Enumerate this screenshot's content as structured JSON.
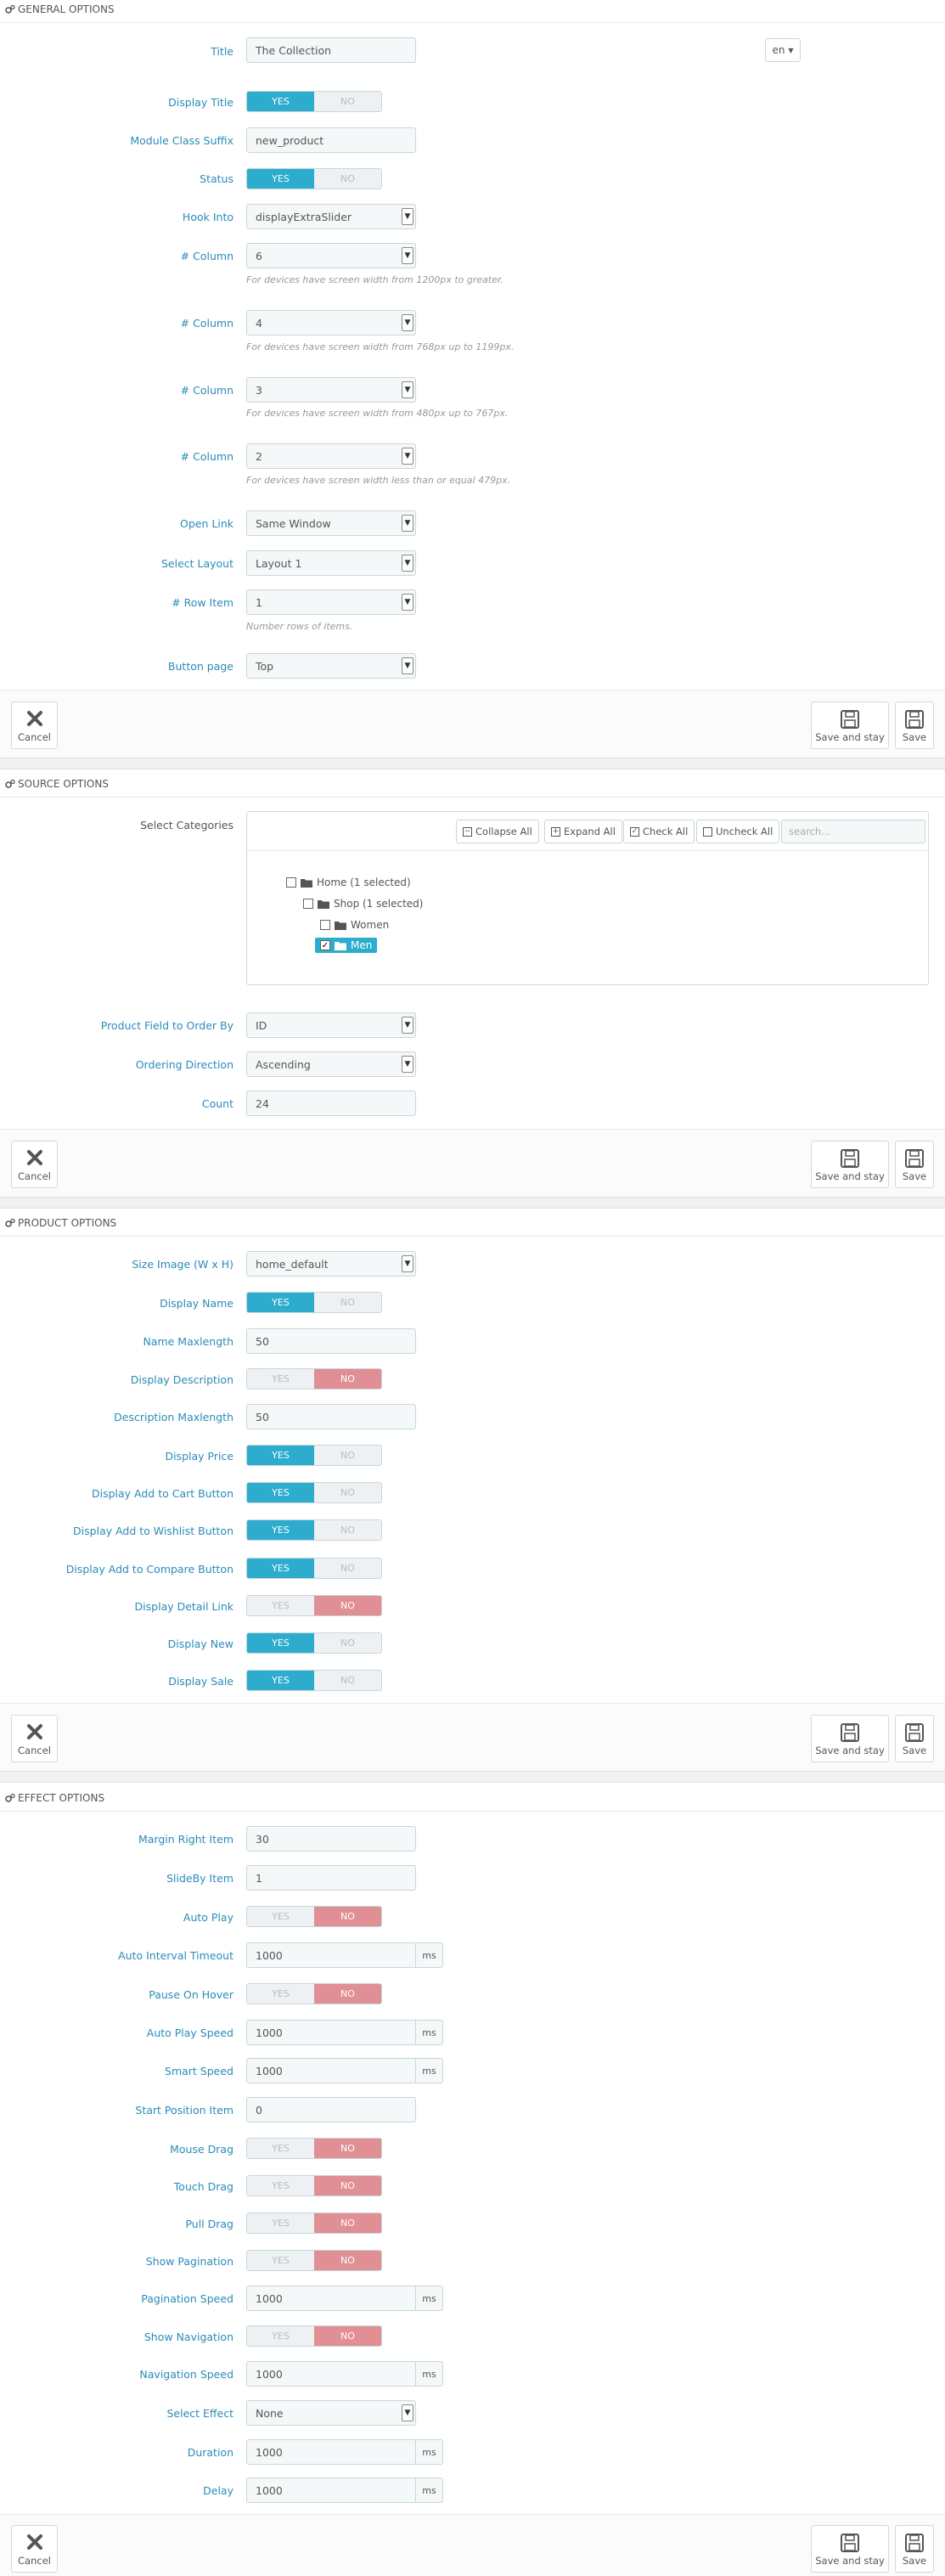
{
  "general": {
    "header": "GENERAL OPTIONS",
    "lang": "en",
    "title_label": "Title",
    "title_value": "The Collection",
    "display_title_label": "Display Title",
    "suffix_label": "Module Class Suffix",
    "suffix_value": "new_product",
    "status_label": "Status",
    "hook_label": "Hook Into",
    "hook_value": "displayExtraSlider",
    "col_label": "# Column",
    "col1": "6",
    "hint1": "For devices have screen width from 1200px to greater.",
    "col2": "4",
    "hint2": "For devices have screen width from 768px up to 1199px.",
    "col3": "3",
    "hint3": "For devices have screen width from 480px up to 767px.",
    "col4": "2",
    "hint4": "For devices have screen width less than or equal 479px.",
    "open_link_label": "Open Link",
    "open_link_value": "Same Window",
    "layout_label": "Select Layout",
    "layout_value": "Layout 1",
    "row_label": "# Row Item",
    "row_value": "1",
    "row_hint": "Number rows of items.",
    "button_page_label": "Button page",
    "button_page_value": "Top"
  },
  "toggle": {
    "yes": "YES",
    "no": "NO"
  },
  "footer": {
    "cancel": "Cancel",
    "save_stay": "Save and stay",
    "save": "Save"
  },
  "source": {
    "header": "SOURCE OPTIONS",
    "cat_label": "Select Categories",
    "collapse": "Collapse All",
    "expand": "Expand All",
    "check": "Check All",
    "uncheck": "Uncheck All",
    "search_placeholder": "search...",
    "tree": {
      "home": "Home (1 selected)",
      "shop": "Shop (1 selected)",
      "women": "Women",
      "men": "Men"
    },
    "order_by_label": "Product Field to Order By",
    "order_by_value": "ID",
    "direction_label": "Ordering Direction",
    "direction_value": "Ascending",
    "count_label": "Count",
    "count_value": "24"
  },
  "product": {
    "header": "PRODUCT OPTIONS",
    "size_label": "Size Image (W x H)",
    "size_value": "home_default",
    "name_label": "Display Name",
    "name_max_label": "Name Maxlength",
    "name_max_value": "50",
    "desc_label": "Display Description",
    "desc_max_label": "Description Maxlength",
    "desc_max_value": "50",
    "price_label": "Display Price",
    "cart_label": "Display Add to Cart Button",
    "wish_label": "Display Add to Wishlist Button",
    "compare_label": "Display Add to Compare Button",
    "detail_label": "Display Detail Link",
    "new_label": "Display New",
    "sale_label": "Display Sale"
  },
  "effect": {
    "header": "EFFECT OPTIONS",
    "margin_label": "Margin Right Item",
    "margin_value": "30",
    "slideby_label": "SlideBy Item",
    "slideby_value": "1",
    "autoplay_label": "Auto Play",
    "interval_label": "Auto Interval Timeout",
    "interval_value": "1000",
    "pause_label": "Pause On Hover",
    "autoplay_speed_label": "Auto Play Speed",
    "autoplay_speed_value": "1000",
    "smart_label": "Smart Speed",
    "smart_value": "1000",
    "start_label": "Start Position Item",
    "start_value": "0",
    "mouse_label": "Mouse Drag",
    "touch_label": "Touch Drag",
    "pull_label": "Pull Drag",
    "show_pag_label": "Show Pagination",
    "pag_speed_label": "Pagination Speed",
    "pag_speed_value": "1000",
    "show_nav_label": "Show Navigation",
    "nav_speed_label": "Navigation Speed",
    "nav_speed_value": "1000",
    "effect_label": "Select Effect",
    "effect_value": "None",
    "duration_label": "Duration",
    "duration_value": "1000",
    "delay_label": "Delay",
    "delay_value": "1000",
    "unit": "ms"
  },
  "colors": {
    "accent": "#2eacce",
    "no_active": "#e08f95",
    "label": "#2a8bb8"
  }
}
